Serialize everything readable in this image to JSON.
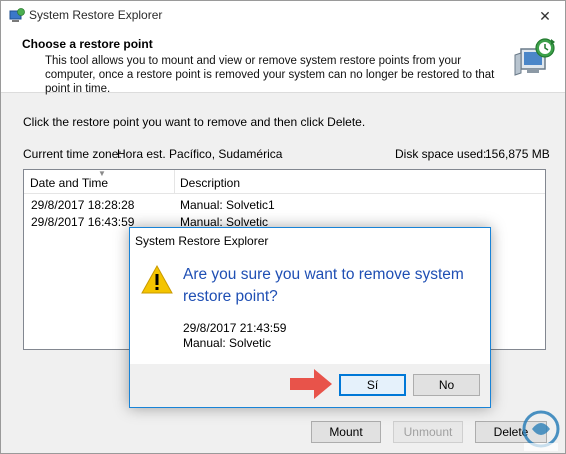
{
  "window": {
    "title": "System Restore Explorer",
    "close_symbol": "✕"
  },
  "header": {
    "title": "Choose a restore point",
    "description": "This tool allows you to mount and view or remove system restore points from your computer, once a restore point is removed your system can no longer be restored to that point in time."
  },
  "main": {
    "instruction": "Click the restore point you want to remove and then click Delete.",
    "timezone_label": "Current time zone:",
    "timezone_value": "Hora est. Pacífico, Sudamérica",
    "disk_label": "Disk space used:",
    "disk_value": "156,875 MB"
  },
  "table": {
    "columns": [
      "Date and Time",
      "Description"
    ],
    "rows": [
      {
        "date": "29/8/2017 18:28:28",
        "description": "Manual: Solvetic1"
      },
      {
        "date": "29/8/2017 16:43:59",
        "description": "Manual: Solvetic"
      }
    ]
  },
  "buttons": {
    "mount": "Mount",
    "unmount": "Unmount",
    "delete": "Delete"
  },
  "dialog": {
    "title": "System Restore Explorer",
    "question": "Are you sure you want to remove system restore point?",
    "date": "29/8/2017 21:43:59",
    "description": "Manual: Solvetic",
    "yes": "Sí",
    "no": "No"
  },
  "colors": {
    "accent_blue": "#0078d7",
    "question_text": "#1f4fb4",
    "warning_yellow": "#f4c400",
    "arrow_red": "#e8534a"
  },
  "icons": {
    "app": "restore-app-icon",
    "header": "computer-restore-icon",
    "warning": "warning-triangle-icon",
    "pointer": "red-arrow-icon",
    "watermark": "solvetic-logo-icon"
  }
}
